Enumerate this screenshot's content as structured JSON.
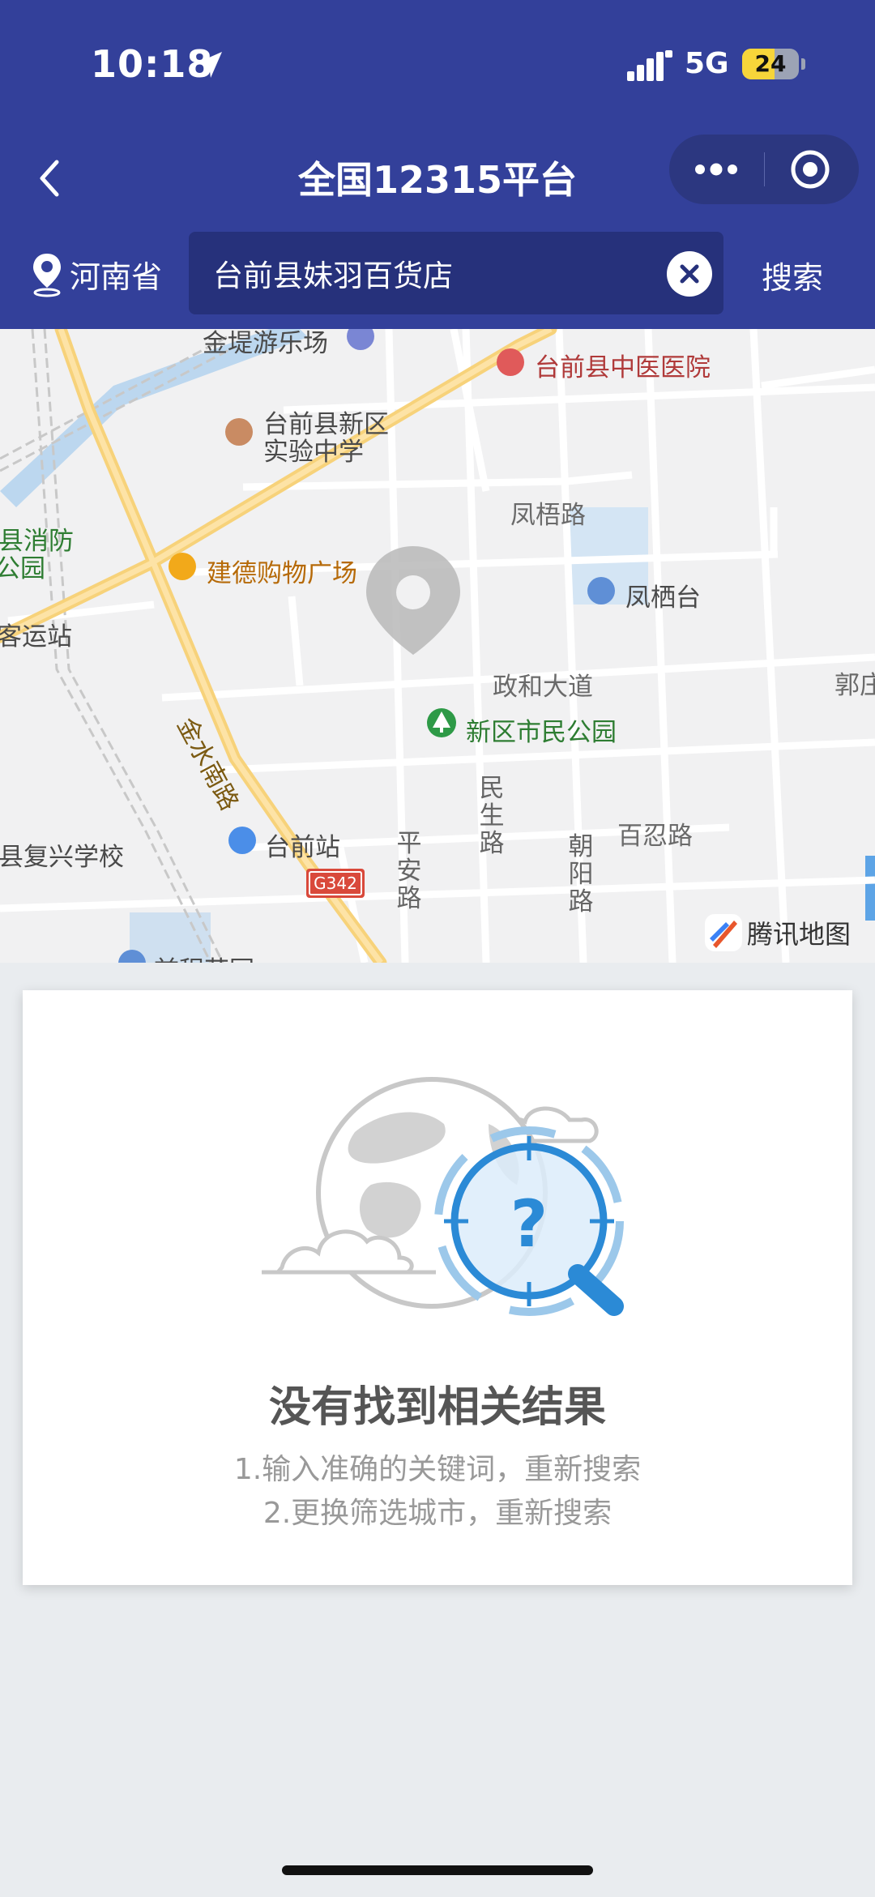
{
  "status_bar": {
    "time": "10:18",
    "network": "5G",
    "battery": "24"
  },
  "navbar": {
    "title": "全国12315平台"
  },
  "search": {
    "region": "河南省",
    "query": "台前县妹羽百货店",
    "button": "搜索"
  },
  "map": {
    "labels": {
      "amusement": "金堤游乐场",
      "hospital": "台前县中医医院",
      "school1_line1": "台前县新区",
      "school1_line2": "实验中学",
      "fire_line1": "县消防",
      "fire_line2": "公园",
      "bus": "客运站",
      "mall": "建德购物广场",
      "fengwu": "凤梧路",
      "fengqi": "凤栖台",
      "zhenghe": "政和大道",
      "guo": "郭庄",
      "jinshui": "金水南路",
      "park": "新区市民公园",
      "minsheng": "民生路",
      "baiyin": "百忍路",
      "chaoyang": "朝阳路",
      "pingan": "平安路",
      "station": "台前站",
      "highway": "G342",
      "school2": "县复兴学校",
      "bottom": "前程花园"
    },
    "attribution": "腾讯地图"
  },
  "empty_state": {
    "title": "没有找到相关结果",
    "tip1": "1.输入准确的关键词，重新搜索",
    "tip2": "2.更换筛选城市，重新搜索"
  }
}
